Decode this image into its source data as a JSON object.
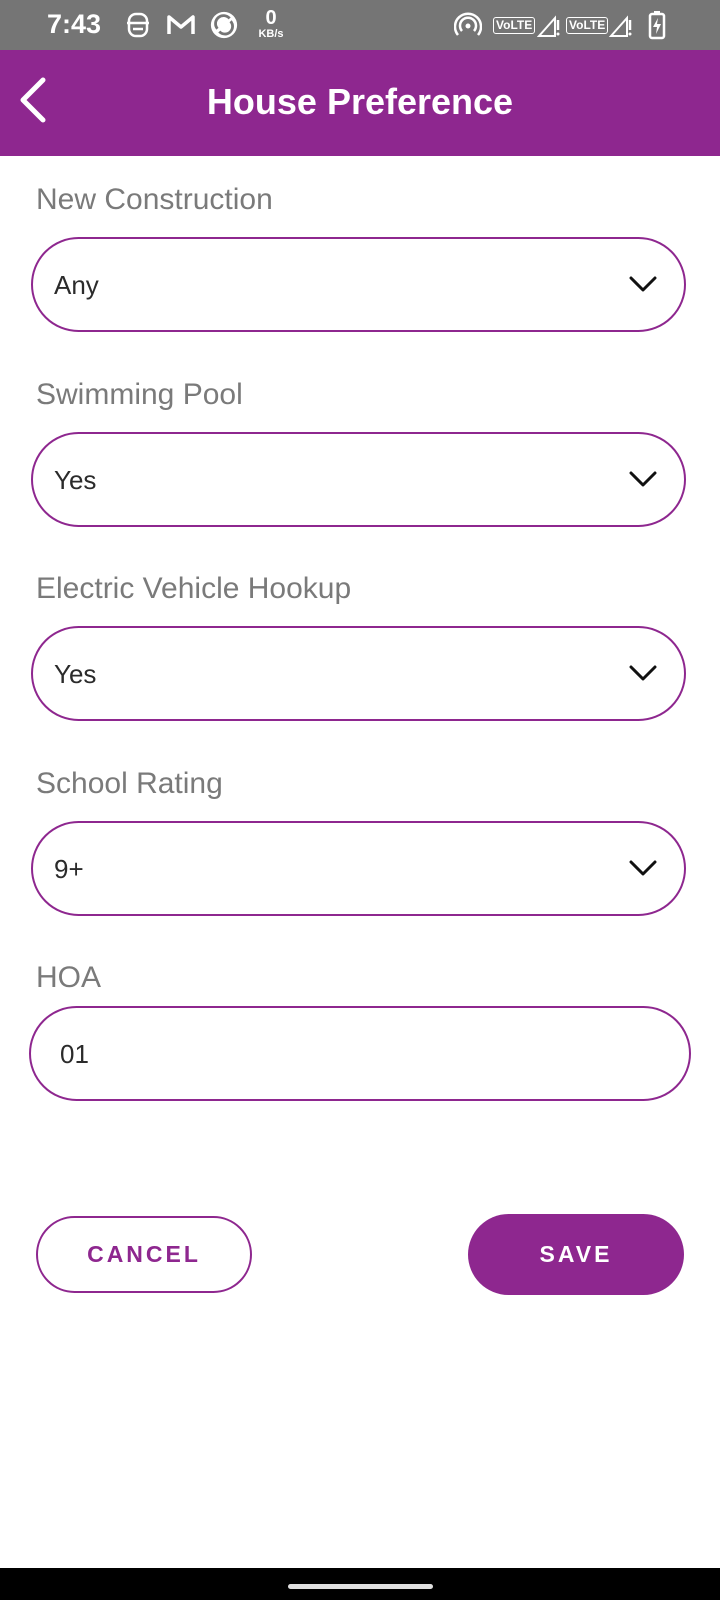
{
  "status_bar": {
    "time": "7:43",
    "net_speed_value": "0",
    "net_speed_unit": "KB/s",
    "volte_1": "VoLTE",
    "volte_2": "VoLTE",
    "icons": [
      "notification-icon",
      "gmail-icon",
      "app-icon",
      "hotspot-icon",
      "signal-icon",
      "signal-icon",
      "battery-charging-icon"
    ]
  },
  "app_bar": {
    "title": "House Preference",
    "back_icon": "chevron-left-icon"
  },
  "form": {
    "new_construction": {
      "label": "New Construction",
      "value": "Any"
    },
    "swimming_pool": {
      "label": "Swimming Pool",
      "value": "Yes"
    },
    "ev_hookup": {
      "label": "Electric Vehicle Hookup",
      "value": "Yes"
    },
    "school_rating": {
      "label": "School Rating",
      "value": "9+"
    },
    "hoa": {
      "label": "HOA",
      "value": "01"
    }
  },
  "actions": {
    "cancel_label": "CANCEL",
    "save_label": "SAVE"
  },
  "colors": {
    "primary": "#8e278f",
    "status_bar": "#757575",
    "label_text": "#7a7a7a"
  }
}
